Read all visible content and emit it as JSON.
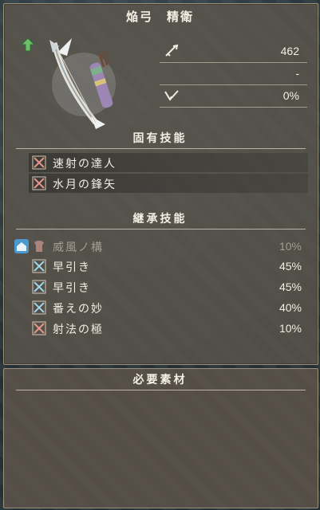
{
  "title": "焔弓　精衛",
  "stats": [
    {
      "icon": "sword-icon",
      "value": "462"
    },
    {
      "icon": "element-icon",
      "value": "-"
    },
    {
      "icon": "crit-icon",
      "value": "0%"
    }
  ],
  "innate": {
    "heading": "固有技能",
    "skills": [
      {
        "icon": "crossed-arrows-icon",
        "label": "速射の達人"
      },
      {
        "icon": "crossed-arrows-icon",
        "label": "水月の鋒矢"
      }
    ]
  },
  "inherit": {
    "heading": "継承技能",
    "skills": [
      {
        "icon": "armor-icon",
        "label": "威風ノ構",
        "pct": "10%",
        "dim": true
      },
      {
        "icon": "crossed-arrows-blue-icon",
        "label": "早引き",
        "pct": "45%"
      },
      {
        "icon": "crossed-arrows-blue-icon",
        "label": "早引き",
        "pct": "45%"
      },
      {
        "icon": "crossed-arrows-blue-icon",
        "label": "番えの妙",
        "pct": "40%"
      },
      {
        "icon": "crossed-arrows-icon",
        "label": "射法の極",
        "pct": "10%"
      }
    ]
  },
  "materials": {
    "heading": "必要素材"
  }
}
